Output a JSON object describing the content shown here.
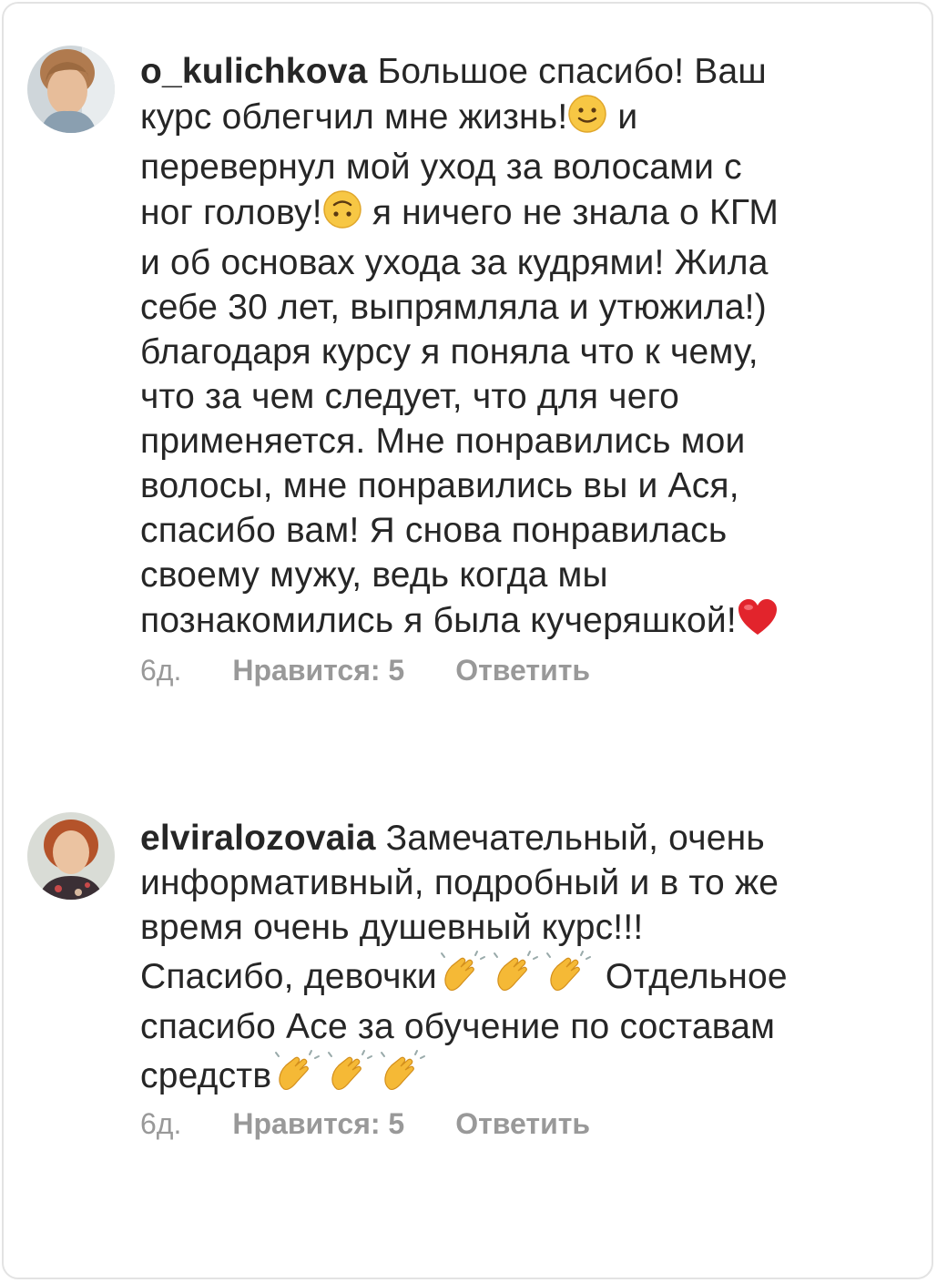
{
  "comments": [
    {
      "username": "o_kulichkova",
      "lines": [
        "Большое спасибо! Ваш",
        "курс облегчил мне жизнь!",
        " и",
        "перевернул мой уход за волосами с",
        "ног голову!",
        " я ничего не знала о КГМ",
        "и об основах ухода за кудрями! Жила",
        "себе 30 лет, выпрямляла и утюжила!)",
        "благодаря курсу я поняла что к чему,",
        "что за чем следует, что для чего",
        "применяется. Мне понравились мои",
        "волосы, мне понравились вы и Ася,",
        "спасибо вам! Я снова понравилась",
        "своему мужу, ведь когда мы",
        "познакомились я была кучеряшкой!"
      ],
      "time": "6д.",
      "likes": "Нравится: 5",
      "reply": "Ответить",
      "emoji_icons": [
        "slightly-smiling-face-icon",
        "upside-down-face-icon",
        "red-heart-icon"
      ]
    },
    {
      "username": "elviralozovaia",
      "lines": [
        "Замечательный, очень",
        "информативный, подробный и в то же",
        "время очень душевный курс!!!",
        "Спасибо, девочки",
        " Отдельное",
        "спасибо Асе за обучение по составам",
        "средств"
      ],
      "time": "6д.",
      "likes": "Нравится: 5",
      "reply": "Ответить",
      "emoji_icons": [
        "clapping-hands-icon"
      ]
    }
  ],
  "colors": {
    "text": "#262626",
    "meta": "#999999",
    "border": "#e3e3e3"
  }
}
